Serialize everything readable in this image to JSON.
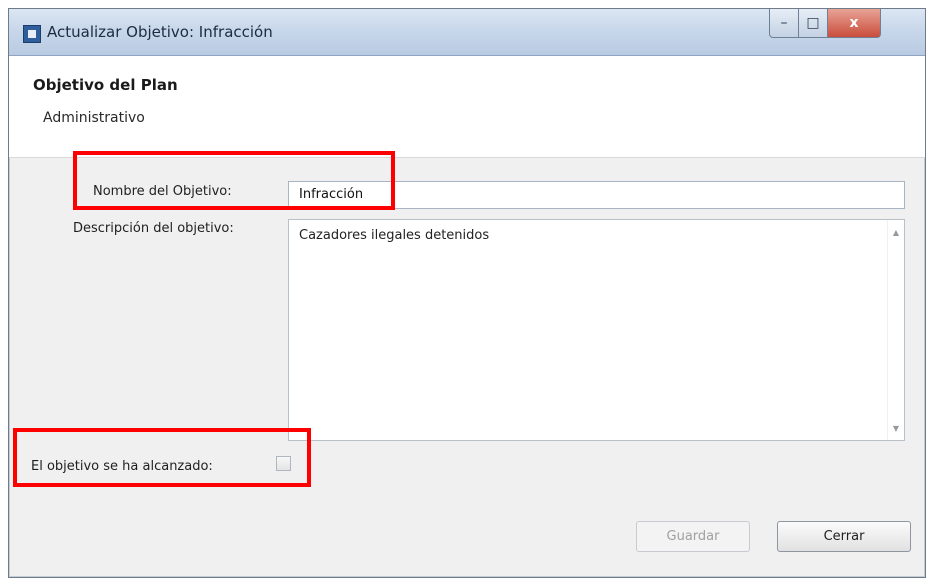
{
  "window": {
    "title": "Actualizar Objetivo: Infracción",
    "controls": {
      "minimize": "–",
      "maximize": "□",
      "close": "x"
    }
  },
  "header": {
    "title": "Objetivo del Plan",
    "subtitle": "Administrativo"
  },
  "form": {
    "name_label": "Nombre del Objetivo:",
    "name_value": "Infracción",
    "description_label": "Descripción del objetivo:",
    "description_value": "Cazadores ilegales detenidos",
    "achieved_label": "El objetivo se ha alcanzado:",
    "achieved_checked": false
  },
  "buttons": {
    "save_label": "Guardar",
    "close_label": "Cerrar"
  },
  "icons": {
    "scroll_up": "▲",
    "scroll_down": "▼"
  },
  "colors": {
    "highlight": "#ff0000"
  }
}
